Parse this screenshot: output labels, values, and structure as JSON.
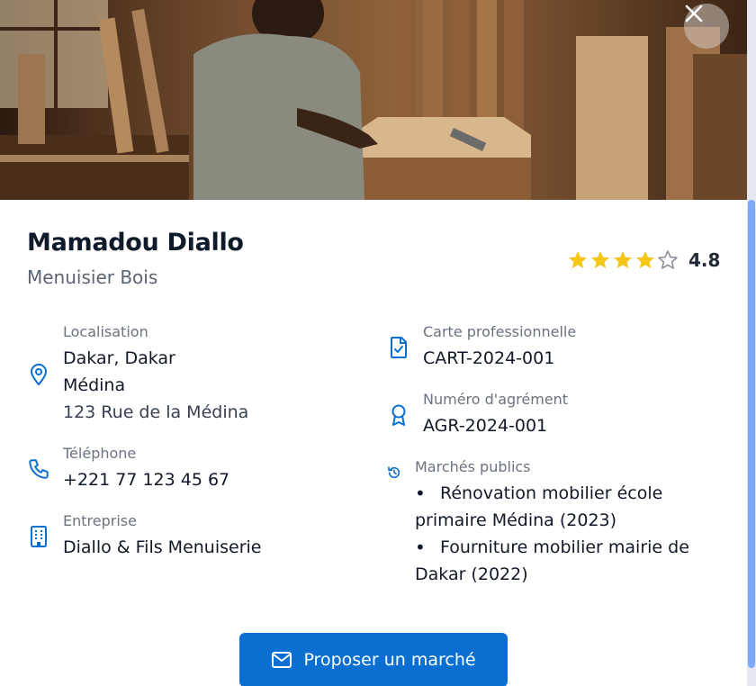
{
  "profile": {
    "name": "Mamadou Diallo",
    "profession": "Menuisier Bois",
    "rating_value": "4.8",
    "stars_filled": 4,
    "stars_total": 5
  },
  "details": {
    "location": {
      "label": "Localisation",
      "line1": "Dakar, Dakar",
      "line2": "Médina",
      "line3": "123 Rue de la Médina",
      "icon": "map-pin-icon"
    },
    "phone": {
      "label": "Téléphone",
      "value": "+221 77 123 45 67",
      "icon": "phone-icon"
    },
    "company": {
      "label": "Entreprise",
      "value": "Diallo & Fils Menuiserie",
      "icon": "building-icon"
    },
    "card": {
      "label": "Carte professionnelle",
      "value": "CART-2024-001",
      "icon": "document-check-icon"
    },
    "approval": {
      "label": "Numéro d'agrément",
      "value": "AGR-2024-001",
      "icon": "award-icon"
    },
    "markets": {
      "label": "Marchés publics",
      "items": [
        "Rénovation mobilier école primaire Médina (2023)",
        "Fourniture mobilier mairie de Dakar (2022)"
      ],
      "icon": "history-icon"
    }
  },
  "actions": {
    "propose_label": "Proposer un marché",
    "close_icon": "close-icon"
  },
  "colors": {
    "accent": "#0b6fd1",
    "star": "#f5c518",
    "icon": "#0b6fd1"
  }
}
